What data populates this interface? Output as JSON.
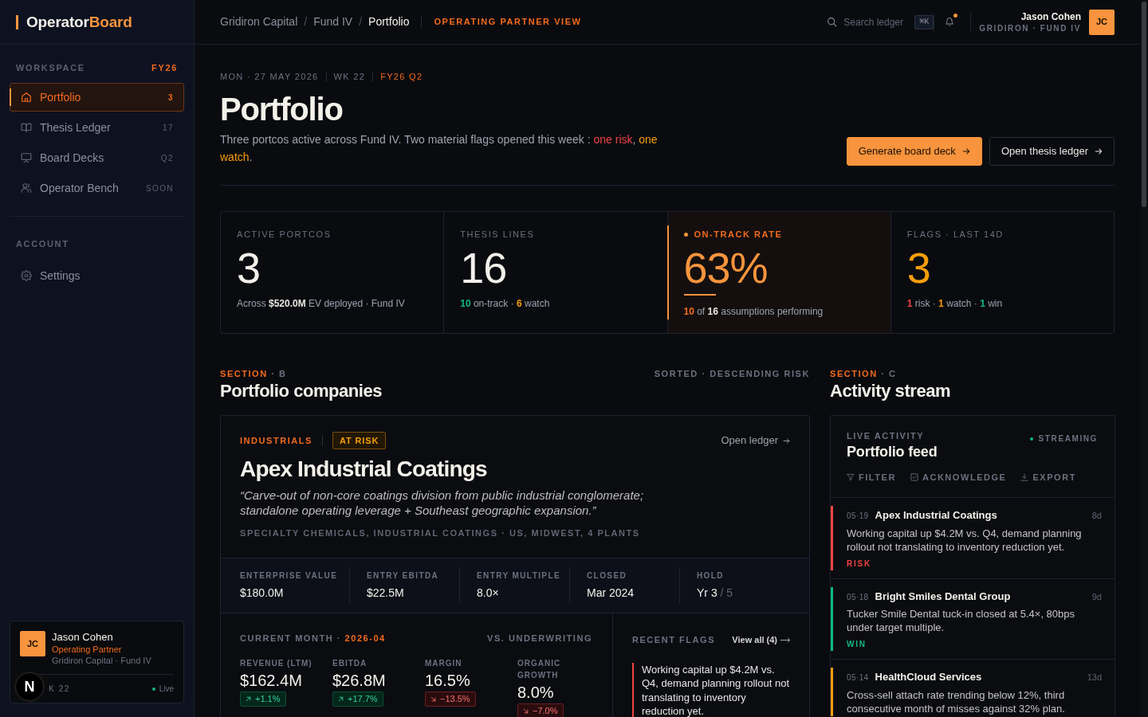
{
  "sidebar": {
    "logo": {
      "text": "Operator",
      "accent": "Board"
    },
    "workspace": {
      "label": "WORKSPACE",
      "tag": "FY26"
    },
    "nav": [
      {
        "label": "Portfolio",
        "count": "3",
        "selected": true
      },
      {
        "label": "Thesis Ledger",
        "count": "17",
        "selected": false
      },
      {
        "label": "Board Decks",
        "count": "Q2",
        "selected": false
      },
      {
        "label": "Operator Bench",
        "count": "SOON",
        "selected": false
      }
    ],
    "account": {
      "label": "ACCOUNT",
      "items": [
        {
          "label": "Settings",
          "selected": false
        }
      ]
    },
    "profile": {
      "initials": "JC",
      "name": "Jason Cohen",
      "role": "Operating Partner",
      "org": "Gridiron Capital · Fund IV",
      "week": "K 22",
      "status": "Live",
      "online": true
    }
  },
  "topbar": {
    "breadcrumb": {
      "separator": "/",
      "items": [
        {
          "label": "Gridiron Capital",
          "current": false
        },
        {
          "label": "Fund IV",
          "current": false
        },
        {
          "label": "Portfolio",
          "current": true
        }
      ]
    },
    "view": "OPERATING PARTNER VIEW",
    "search": {
      "placeholder": "Search ledger",
      "shortcut": "⌘K"
    },
    "notifications": {
      "unread": true
    },
    "user": {
      "name": "Jason Cohen",
      "org": "GRIDIRON · FUND IV",
      "initials": "JC"
    }
  },
  "header": {
    "date": "MON · 27 MAY 2026",
    "week": "WK 22",
    "quarter": "FY26 Q2",
    "title": "Portfolio",
    "subtitle": [
      {
        "text": "Three portcos active across Fund IV. Two material flags opened this week : ",
        "kind": "plain"
      },
      {
        "text": "one risk",
        "kind": "risk"
      },
      {
        "text": ", ",
        "kind": "plain"
      },
      {
        "text": "one watch",
        "kind": "watch"
      },
      {
        "text": ".",
        "kind": "plain"
      }
    ],
    "actions": [
      {
        "label": "Generate board deck",
        "kind": "primary"
      },
      {
        "label": "Open thesis ledger",
        "kind": "outline"
      }
    ]
  },
  "stats": [
    {
      "label": "ACTIVE PORTCOS",
      "value": "3",
      "kind": "plain",
      "highlighted": false,
      "caption": [
        {
          "text": "Across ",
          "kind": "plain"
        },
        {
          "text": "$520.0M",
          "kind": "strong"
        },
        {
          "text": " EV deployed · Fund IV",
          "kind": "plain"
        }
      ]
    },
    {
      "label": "THESIS LINES",
      "value": "16",
      "kind": "plain",
      "highlighted": false,
      "caption": [
        {
          "text": "10",
          "kind": "good"
        },
        {
          "text": " on-track · ",
          "kind": "plain"
        },
        {
          "text": "6",
          "kind": "watch"
        },
        {
          "text": " watch",
          "kind": "plain"
        }
      ]
    },
    {
      "label": "ON-TRACK RATE",
      "value": "63%",
      "kind": "accent",
      "highlighted": true,
      "caption": [
        {
          "text": "10",
          "kind": "accent"
        },
        {
          "text": " of ",
          "kind": "plain"
        },
        {
          "text": "16",
          "kind": "strong"
        },
        {
          "text": " assumptions performing",
          "kind": "plain"
        }
      ]
    },
    {
      "label": "FLAGS · LAST 14D",
      "value": "3",
      "kind": "watch",
      "highlighted": false,
      "caption": [
        {
          "text": "1",
          "kind": "risk"
        },
        {
          "text": " risk · ",
          "kind": "plain"
        },
        {
          "text": "1",
          "kind": "watch"
        },
        {
          "text": " watch · ",
          "kind": "plain"
        },
        {
          "text": "1",
          "kind": "good"
        },
        {
          "text": " win",
          "kind": "plain"
        }
      ]
    }
  ],
  "companies": {
    "eyebrow": "SECTION",
    "letter": "· B",
    "title": "Portfolio companies",
    "sort": "SORTED · DESCENDING RISK",
    "items": [
      {
        "sector": "INDUSTRIALS",
        "status": "AT RISK",
        "link": "Open ledger",
        "name": "Apex Industrial Coatings",
        "thesis": "“Carve-out of non-core coatings division from public industrial conglomerate; standalone operating leverage + Southeast geographic expansion.”",
        "tags": "SPECIALTY CHEMICALS, INDUSTRIAL COATINGS · US, MIDWEST, 4 PLANTS",
        "terms": [
          {
            "label": "ENTERPRISE VALUE",
            "value": "$180.0M"
          },
          {
            "label": "ENTRY EBITDA",
            "value": "$22.5M"
          },
          {
            "label": "ENTRY MULTIPLE",
            "value": "8.0×"
          },
          {
            "label": "CLOSED",
            "value": "Mar 2024"
          },
          {
            "label": "HOLD",
            "value": "Yr 3",
            "suffix": "/ 5"
          }
        ],
        "current": {
          "label": "CURRENT MONTH ·",
          "period": "2026-04",
          "compare": "VS. UNDERWRITING",
          "kpis": [
            {
              "label": "REVENUE (LTM)",
              "value": "$162.4M",
              "delta": "+1.1%",
              "kind": "up"
            },
            {
              "label": "EBITDA",
              "value": "$26.8M",
              "delta": "+17.7%",
              "kind": "up"
            },
            {
              "label": "MARGIN",
              "value": "16.5%",
              "delta": "−13.5%",
              "kind": "down"
            },
            {
              "label": "ORGANIC GROWTH",
              "value": "8.0%",
              "delta": "−7.0%",
              "kind": "down"
            }
          ]
        },
        "flags": {
          "label": "RECENT FLAGS",
          "link": "View all (4)",
          "items": [
            {
              "text": "Working capital up $4.2M vs. Q4, demand planning rollout not translating to inventory reduction yet.",
              "color": "#ef4444"
            }
          ]
        }
      }
    ]
  },
  "activity": {
    "eyebrow": "SECTION",
    "letter": "· C",
    "title": "Activity stream",
    "feed": {
      "eyebrow": "LIVE ACTIVITY",
      "title": "Portfolio feed",
      "status": "STREAMING",
      "streaming": true,
      "actions": [
        "FILTER",
        "ACKNOWLEDGE",
        "EXPORT"
      ],
      "items": [
        {
          "date": "05·19",
          "title": "Apex Industrial Coatings",
          "age": "8d",
          "text": "Working capital up $4.2M vs. Q4, demand planning rollout not translating to inventory reduction yet.",
          "tag": "RISK",
          "color": "#ef4444"
        },
        {
          "date": "05·18",
          "title": "Bright Smiles Dental Group",
          "age": "9d",
          "text": "Tucker Smile Dental tuck-in closed at 5.4×, 80bps under target multiple.",
          "tag": "WIN",
          "color": "#10b981"
        },
        {
          "date": "05·14",
          "title": "HealthCloud Services",
          "age": "13d",
          "text": "Cross-sell attach rate trending below 12%, third consecutive month of misses against 32% plan.",
          "color": "#f59e0b"
        }
      ]
    }
  },
  "dev_indicator": {
    "label": "N"
  }
}
